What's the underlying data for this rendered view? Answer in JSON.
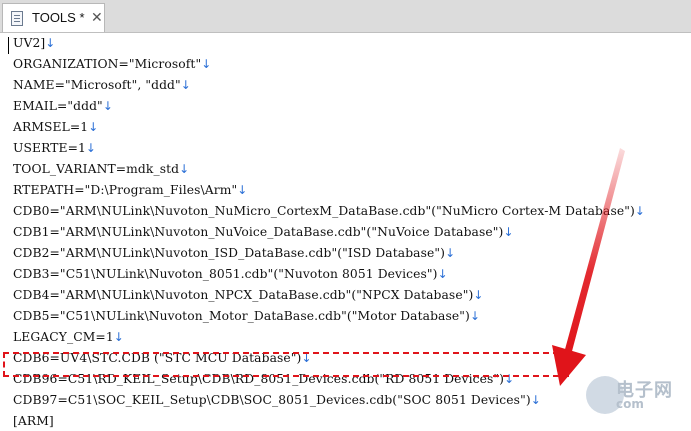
{
  "tab": {
    "title": "TOOLS *",
    "close_glyph": "✕",
    "icon": "document-icon"
  },
  "eol_marker": "↓",
  "lines": [
    {
      "text": "UV2]"
    },
    {
      "text": "ORGANIZATION=\"Microsoft\""
    },
    {
      "text": "NAME=\"Microsoft\", \"ddd\""
    },
    {
      "text": "EMAIL=\"ddd\""
    },
    {
      "text": "ARMSEL=1"
    },
    {
      "text": "USERTE=1"
    },
    {
      "text": "TOOL_VARIANT=mdk_std"
    },
    {
      "text": "RTEPATH=\"D:\\Program_Files\\Arm\""
    },
    {
      "text": "CDB0=\"ARM\\NULink\\Nuvoton_NuMicro_CortexM_DataBase.cdb\"(\"NuMicro Cortex-M Database\")"
    },
    {
      "text": "CDB1=\"ARM\\NULink\\Nuvoton_NuVoice_DataBase.cdb\"(\"NuVoice Database\")"
    },
    {
      "text": "CDB2=\"ARM\\NULink\\Nuvoton_ISD_DataBase.cdb\"(\"ISD Database\")"
    },
    {
      "text": "CDB3=\"C51\\NULink\\Nuvoton_8051.cdb\"(\"Nuvoton 8051 Devices\")"
    },
    {
      "text": "CDB4=\"ARM\\NULink\\Nuvoton_NPCX_DataBase.cdb\"(\"NPCX Database\")"
    },
    {
      "text": "CDB5=\"C51\\NULink\\Nuvoton_Motor_DataBase.cdb\"(\"Motor Database\")"
    },
    {
      "text": "LEGACY_CM=1"
    },
    {
      "text": "CDB6=UV4\\STC.CDB (\"STC MCU Database\")"
    },
    {
      "text": "CDB96=C51\\RD_KEIL_Setup\\CDB\\RD_8051_Devices.cdb(\"RD 8051 Devices\")"
    },
    {
      "text": "CDB97=C51\\SOC_KEIL_Setup\\CDB\\SOC_8051_Devices.cdb(\"SOC 8051 Devices\")"
    },
    {
      "text": "[ARM]"
    }
  ],
  "annotation": {
    "color": "#e0141a",
    "style": "dashed-box-with-arrow"
  },
  "watermark": {
    "text": "电子网",
    "sub": "com"
  }
}
